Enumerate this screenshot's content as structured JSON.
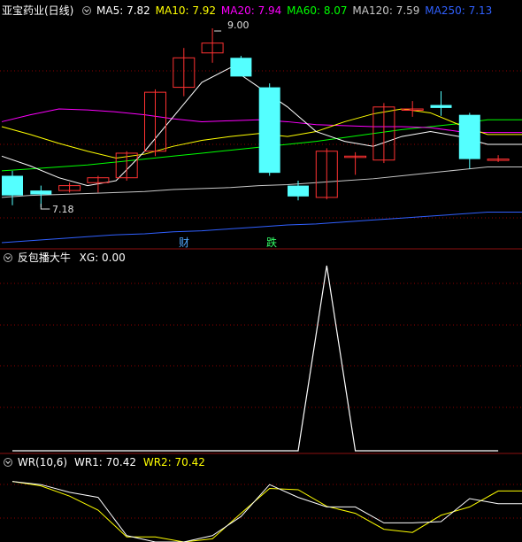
{
  "stock_title": "亚宝药业(日线)",
  "ma": [
    {
      "label": "MA5: 7.82",
      "color": "#ffffff"
    },
    {
      "label": "MA10: 7.92",
      "color": "#ffff00"
    },
    {
      "label": "MA20: 7.94",
      "color": "#ff00ff"
    },
    {
      "label": "MA60: 8.07",
      "color": "#00ff00"
    },
    {
      "label": "MA120: 7.59",
      "color": "#c8c8c8"
    },
    {
      "label": "MA250: 7.13",
      "color": "#3060ff"
    }
  ],
  "price_high_label": "9.00",
  "price_low_label": "7.18",
  "markers": [
    {
      "text": "财",
      "color": "#4fa8ff"
    },
    {
      "text": "跌",
      "color": "#33ff66"
    }
  ],
  "indicator": {
    "name": "反包播大牛",
    "xg_label": "XG: 0.00"
  },
  "wr": {
    "name": "WR(10,6)",
    "wr1_label": "WR1: 70.42",
    "wr2_label": "WR2: 70.42"
  },
  "colors": {
    "up": "#ff3232",
    "down": "#54ffff",
    "grid": "#8b0000",
    "ma5": "#ffffff",
    "ma10": "#ffff00",
    "ma20": "#ff00ff",
    "ma60": "#00ff00",
    "ma120": "#c8c8c8",
    "ma250": "#3060ff"
  },
  "candles": [
    {
      "o": 7.5,
      "h": 7.55,
      "l": 7.2,
      "c": 7.3
    },
    {
      "o": 7.35,
      "h": 7.4,
      "l": 7.18,
      "c": 7.31
    },
    {
      "o": 7.35,
      "h": 7.43,
      "l": 7.33,
      "c": 7.4
    },
    {
      "o": 7.43,
      "h": 7.5,
      "l": 7.33,
      "c": 7.48
    },
    {
      "o": 7.48,
      "h": 7.75,
      "l": 7.45,
      "c": 7.73
    },
    {
      "o": 7.75,
      "h": 8.38,
      "l": 7.7,
      "c": 8.35
    },
    {
      "o": 8.4,
      "h": 8.8,
      "l": 8.31,
      "c": 8.7
    },
    {
      "o": 8.75,
      "h": 9.0,
      "l": 8.65,
      "c": 8.85
    },
    {
      "o": 8.7,
      "h": 8.72,
      "l": 8.55,
      "c": 8.51
    },
    {
      "o": 8.4,
      "h": 8.44,
      "l": 7.5,
      "c": 7.53
    },
    {
      "o": 7.4,
      "h": 7.45,
      "l": 7.25,
      "c": 7.29
    },
    {
      "o": 7.28,
      "h": 7.78,
      "l": 7.26,
      "c": 7.75
    },
    {
      "o": 7.7,
      "h": 7.74,
      "l": 7.51,
      "c": 7.7
    },
    {
      "o": 7.66,
      "h": 8.24,
      "l": 7.63,
      "c": 8.2
    },
    {
      "o": 8.18,
      "h": 8.26,
      "l": 8.1,
      "c": 8.18
    },
    {
      "o": 8.22,
      "h": 8.36,
      "l": 8.11,
      "c": 8.19
    },
    {
      "o": 8.12,
      "h": 8.14,
      "l": 7.57,
      "c": 7.67
    },
    {
      "o": 7.66,
      "h": 7.71,
      "l": 7.64,
      "c": 7.67
    }
  ],
  "ma_series": {
    "ma5": [
      7.7,
      7.6,
      7.48,
      7.4,
      7.45,
      7.75,
      8.1,
      8.45,
      8.6,
      8.4,
      8.2,
      7.95,
      7.85,
      7.8,
      7.9,
      7.95,
      7.9,
      7.82
    ],
    "ma10": [
      8.0,
      7.92,
      7.83,
      7.75,
      7.68,
      7.72,
      7.8,
      7.86,
      7.9,
      7.93,
      7.9,
      7.95,
      8.05,
      8.13,
      8.18,
      8.14,
      8.02,
      7.92
    ],
    "ma20": [
      8.05,
      8.12,
      8.18,
      8.17,
      8.15,
      8.12,
      8.08,
      8.05,
      8.06,
      8.07,
      8.05,
      8.02,
      8.01,
      8.0,
      8.0,
      7.99,
      7.95,
      7.94
    ],
    "ma60": [
      7.55,
      7.57,
      7.59,
      7.61,
      7.64,
      7.67,
      7.7,
      7.73,
      7.76,
      7.79,
      7.82,
      7.85,
      7.89,
      7.93,
      7.97,
      8.0,
      8.03,
      8.07
    ],
    "ma120": [
      7.28,
      7.3,
      7.31,
      7.32,
      7.33,
      7.34,
      7.36,
      7.37,
      7.38,
      7.4,
      7.41,
      7.43,
      7.45,
      7.47,
      7.5,
      7.53,
      7.56,
      7.59
    ],
    "ma250": [
      6.82,
      6.84,
      6.86,
      6.88,
      6.9,
      6.91,
      6.93,
      6.94,
      6.96,
      6.98,
      7.0,
      7.01,
      7.03,
      7.05,
      7.07,
      7.09,
      7.11,
      7.13
    ]
  },
  "xg_values": [
    0,
    0,
    0,
    0,
    0,
    0,
    0,
    0,
    0,
    0,
    0,
    1,
    0,
    0,
    0,
    0,
    0,
    0
  ],
  "wr1": [
    5,
    10,
    22,
    30,
    90,
    100,
    100,
    90,
    60,
    10,
    30,
    45,
    45,
    70,
    70,
    68,
    32,
    40
  ],
  "wr2": [
    5,
    12,
    28,
    50,
    92,
    92,
    100,
    95,
    55,
    16,
    18,
    44,
    55,
    80,
    85,
    58,
    45,
    20
  ]
}
